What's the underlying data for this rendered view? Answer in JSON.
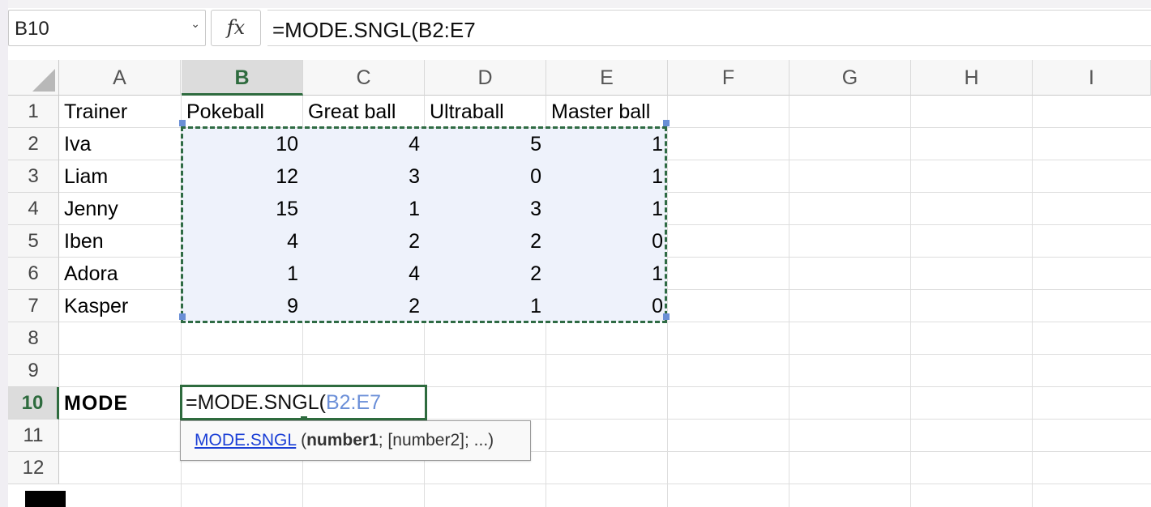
{
  "formula_bar": {
    "name_box": "B10",
    "name_box_caret": "⌄",
    "fx_label": "fx",
    "formula": "=MODE.SNGL(B2:E7"
  },
  "columns": [
    "A",
    "B",
    "C",
    "D",
    "E",
    "F",
    "G",
    "H",
    "I"
  ],
  "selected_column": "B",
  "rows": [
    "1",
    "2",
    "3",
    "4",
    "5",
    "6",
    "7",
    "8",
    "9",
    "10",
    "11",
    "12"
  ],
  "selected_row": "10",
  "header_row": [
    "Trainer",
    "Pokeball",
    "Great ball",
    "Ultraball",
    "Master ball"
  ],
  "data_rows": [
    {
      "trainer": "Iva",
      "values": [
        "10",
        "4",
        "5",
        "1"
      ]
    },
    {
      "trainer": "Liam",
      "values": [
        "12",
        "3",
        "0",
        "1"
      ]
    },
    {
      "trainer": "Jenny",
      "values": [
        "15",
        "1",
        "3",
        "1"
      ]
    },
    {
      "trainer": "Iben",
      "values": [
        "4",
        "2",
        "2",
        "0"
      ]
    },
    {
      "trainer": "Adora",
      "values": [
        "1",
        "4",
        "2",
        "1"
      ]
    },
    {
      "trainer": "Kasper",
      "values": [
        "9",
        "2",
        "1",
        "0"
      ]
    }
  ],
  "mode_label": "MODE",
  "active_cell": {
    "prefix": "=MODE.SNGL(",
    "range_ref": "B2:E7"
  },
  "tooltip": {
    "function_name": "MODE.SNGL",
    "open": " (",
    "arg1": "number1",
    "rest": "; [number2]; ...)"
  },
  "colors": {
    "selection_green": "#2e6b3e",
    "range_ref_blue": "#6b8fd8",
    "range_fill": "#eef2fb",
    "link_blue": "#1b3fd6"
  }
}
